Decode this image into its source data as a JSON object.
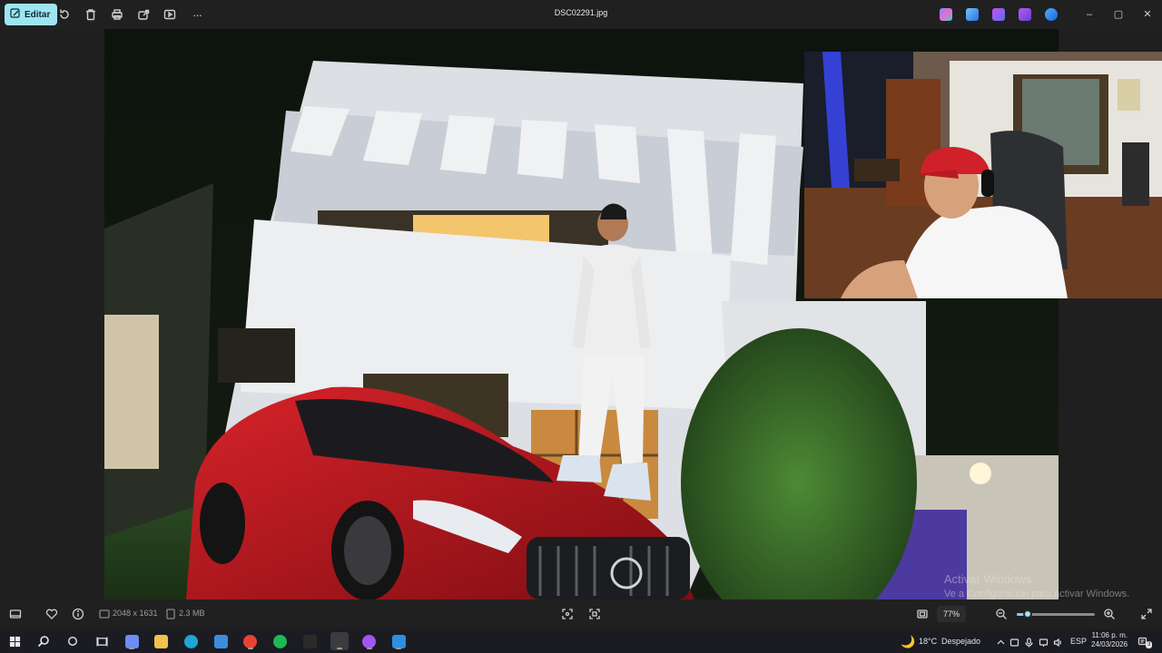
{
  "toolbar": {
    "edit_label": "Editar",
    "filename": "DSC02291.jpg",
    "more_label": "···",
    "icons": [
      "pencil-icon",
      "rotate-icon",
      "delete-icon",
      "print-icon",
      "share-icon",
      "slideshow-icon",
      "more-icon"
    ],
    "tray_apps": [
      "copilot-icon",
      "photos-icon",
      "clipchamp-icon",
      "designer-icon",
      "onedrive-icon"
    ],
    "window_controls": {
      "minimize": "–",
      "maximize": "▢",
      "close": "✕"
    }
  },
  "watermark": {
    "line1": "Activar Windows",
    "line2": "Ve a Configuración para activar Windows."
  },
  "status": {
    "dimensions": "2048 x 1631",
    "filesize": "2.3 MB",
    "zoom": "77%",
    "zoom_fraction": 0.14
  },
  "taskbar": {
    "weather_temp": "18°C",
    "weather_text": "Despejado",
    "language": "ESP",
    "time": "11:06 p. m.",
    "date": "24/03/2026",
    "notification_count": "3",
    "apps": [
      {
        "name": "copilot",
        "color": "#6e8cf5"
      },
      {
        "name": "file-explorer",
        "color": "#f2c14e"
      },
      {
        "name": "edge",
        "color": "#1fa6d6"
      },
      {
        "name": "store",
        "color": "#3b8de0"
      },
      {
        "name": "chrome",
        "color": "#e94235"
      },
      {
        "name": "spotify",
        "color": "#1db954"
      },
      {
        "name": "epic-games",
        "color": "#2a2a2a"
      },
      {
        "name": "obs",
        "color": "#3d3d3d"
      },
      {
        "name": "messenger",
        "color": "#a355f0"
      },
      {
        "name": "photos",
        "color": "#2d8fe0"
      }
    ]
  }
}
